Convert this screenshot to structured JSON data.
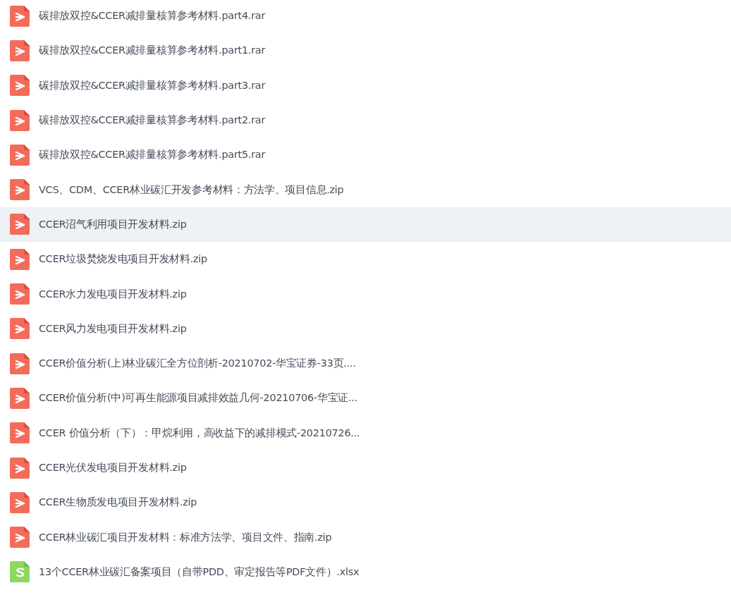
{
  "files": [
    {
      "name": "碳排放双控&CCER减排量核算参考材料.part4.rar",
      "kind": "pdf",
      "highlighted": false
    },
    {
      "name": "碳排放双控&CCER减排量核算参考材料.part1.rar",
      "kind": "pdf",
      "highlighted": false
    },
    {
      "name": "碳排放双控&CCER减排量核算参考材料.part3.rar",
      "kind": "pdf",
      "highlighted": false
    },
    {
      "name": "碳排放双控&CCER减排量核算参考材料.part2.rar",
      "kind": "pdf",
      "highlighted": false
    },
    {
      "name": "碳排放双控&CCER减排量核算参考材料.part5.rar",
      "kind": "pdf",
      "highlighted": false
    },
    {
      "name": "VCS、CDM、CCER林业碳汇开发参考材料：方法学、项目信息.zip",
      "kind": "pdf",
      "highlighted": false
    },
    {
      "name": "CCER沼气利用项目开发材料.zip",
      "kind": "pdf",
      "highlighted": true
    },
    {
      "name": "CCER垃圾焚烧发电项目开发材料.zip",
      "kind": "pdf",
      "highlighted": false
    },
    {
      "name": "CCER水力发电项目开发材料.zip",
      "kind": "pdf",
      "highlighted": false
    },
    {
      "name": "CCER风力发电项目开发材料.zip",
      "kind": "pdf",
      "highlighted": false
    },
    {
      "name": "CCER价值分析(上)林业碳汇全方位剖析-20210702-华宝证券-33页....",
      "kind": "pdf",
      "highlighted": false
    },
    {
      "name": "CCER价值分析(中)可再生能源项目减排效益几何-20210706-华宝证...",
      "kind": "pdf",
      "highlighted": false
    },
    {
      "name": "CCER 价值分析（下）：甲烷利用，高收益下的减排模式-20210726...",
      "kind": "pdf",
      "highlighted": false
    },
    {
      "name": "CCER光伏发电项目开发材料.zip",
      "kind": "pdf",
      "highlighted": false
    },
    {
      "name": "CCER生物质发电项目开发材料.zip",
      "kind": "pdf",
      "highlighted": false
    },
    {
      "name": "CCER林业碳汇项目开发材料：标准方法学、项目文件、指南.zip",
      "kind": "pdf",
      "highlighted": false
    },
    {
      "name": "13个CCER林业碳汇备案项目（自带PDD、审定报告等PDF文件）.xlsx",
      "kind": "sheet",
      "highlighted": false
    }
  ]
}
